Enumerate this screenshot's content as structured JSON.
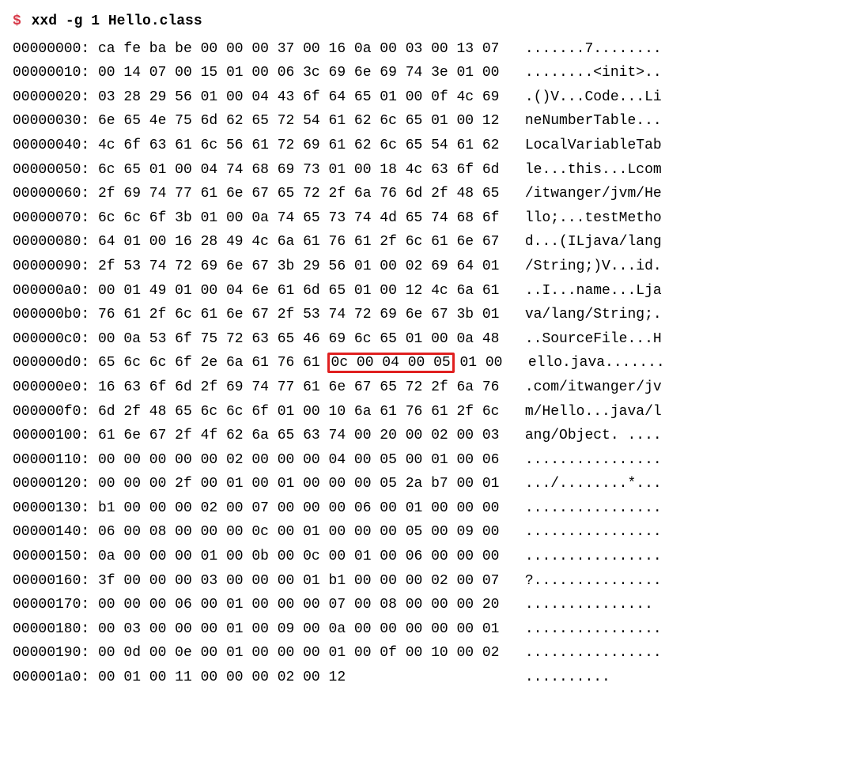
{
  "prompt": "$",
  "command": "xxd -g 1 Hello.class",
  "highlight": {
    "rowOffset": "000000d0",
    "startByte": 9,
    "endByte": 13
  },
  "rows": [
    {
      "offset": "00000000",
      "hex": [
        "ca",
        "fe",
        "ba",
        "be",
        "00",
        "00",
        "00",
        "37",
        "00",
        "16",
        "0a",
        "00",
        "03",
        "00",
        "13",
        "07"
      ],
      "ascii": ".......7........"
    },
    {
      "offset": "00000010",
      "hex": [
        "00",
        "14",
        "07",
        "00",
        "15",
        "01",
        "00",
        "06",
        "3c",
        "69",
        "6e",
        "69",
        "74",
        "3e",
        "01",
        "00"
      ],
      "ascii": "........<init>.."
    },
    {
      "offset": "00000020",
      "hex": [
        "03",
        "28",
        "29",
        "56",
        "01",
        "00",
        "04",
        "43",
        "6f",
        "64",
        "65",
        "01",
        "00",
        "0f",
        "4c",
        "69"
      ],
      "ascii": ".()V...Code...Li"
    },
    {
      "offset": "00000030",
      "hex": [
        "6e",
        "65",
        "4e",
        "75",
        "6d",
        "62",
        "65",
        "72",
        "54",
        "61",
        "62",
        "6c",
        "65",
        "01",
        "00",
        "12"
      ],
      "ascii": "neNumberTable..."
    },
    {
      "offset": "00000040",
      "hex": [
        "4c",
        "6f",
        "63",
        "61",
        "6c",
        "56",
        "61",
        "72",
        "69",
        "61",
        "62",
        "6c",
        "65",
        "54",
        "61",
        "62"
      ],
      "ascii": "LocalVariableTab"
    },
    {
      "offset": "00000050",
      "hex": [
        "6c",
        "65",
        "01",
        "00",
        "04",
        "74",
        "68",
        "69",
        "73",
        "01",
        "00",
        "18",
        "4c",
        "63",
        "6f",
        "6d"
      ],
      "ascii": "le...this...Lcom"
    },
    {
      "offset": "00000060",
      "hex": [
        "2f",
        "69",
        "74",
        "77",
        "61",
        "6e",
        "67",
        "65",
        "72",
        "2f",
        "6a",
        "76",
        "6d",
        "2f",
        "48",
        "65"
      ],
      "ascii": "/itwanger/jvm/He"
    },
    {
      "offset": "00000070",
      "hex": [
        "6c",
        "6c",
        "6f",
        "3b",
        "01",
        "00",
        "0a",
        "74",
        "65",
        "73",
        "74",
        "4d",
        "65",
        "74",
        "68",
        "6f"
      ],
      "ascii": "llo;...testMetho"
    },
    {
      "offset": "00000080",
      "hex": [
        "64",
        "01",
        "00",
        "16",
        "28",
        "49",
        "4c",
        "6a",
        "61",
        "76",
        "61",
        "2f",
        "6c",
        "61",
        "6e",
        "67"
      ],
      "ascii": "d...(ILjava/lang"
    },
    {
      "offset": "00000090",
      "hex": [
        "2f",
        "53",
        "74",
        "72",
        "69",
        "6e",
        "67",
        "3b",
        "29",
        "56",
        "01",
        "00",
        "02",
        "69",
        "64",
        "01"
      ],
      "ascii": "/String;)V...id."
    },
    {
      "offset": "000000a0",
      "hex": [
        "00",
        "01",
        "49",
        "01",
        "00",
        "04",
        "6e",
        "61",
        "6d",
        "65",
        "01",
        "00",
        "12",
        "4c",
        "6a",
        "61"
      ],
      "ascii": "..I...name...Lja"
    },
    {
      "offset": "000000b0",
      "hex": [
        "76",
        "61",
        "2f",
        "6c",
        "61",
        "6e",
        "67",
        "2f",
        "53",
        "74",
        "72",
        "69",
        "6e",
        "67",
        "3b",
        "01"
      ],
      "ascii": "va/lang/String;."
    },
    {
      "offset": "000000c0",
      "hex": [
        "00",
        "0a",
        "53",
        "6f",
        "75",
        "72",
        "63",
        "65",
        "46",
        "69",
        "6c",
        "65",
        "01",
        "00",
        "0a",
        "48"
      ],
      "ascii": "..SourceFile...H"
    },
    {
      "offset": "000000d0",
      "hex": [
        "65",
        "6c",
        "6c",
        "6f",
        "2e",
        "6a",
        "61",
        "76",
        "61",
        "0c",
        "00",
        "04",
        "00",
        "05",
        "01",
        "00"
      ],
      "ascii": "ello.java......."
    },
    {
      "offset": "000000e0",
      "hex": [
        "16",
        "63",
        "6f",
        "6d",
        "2f",
        "69",
        "74",
        "77",
        "61",
        "6e",
        "67",
        "65",
        "72",
        "2f",
        "6a",
        "76"
      ],
      "ascii": ".com/itwanger/jv"
    },
    {
      "offset": "000000f0",
      "hex": [
        "6d",
        "2f",
        "48",
        "65",
        "6c",
        "6c",
        "6f",
        "01",
        "00",
        "10",
        "6a",
        "61",
        "76",
        "61",
        "2f",
        "6c"
      ],
      "ascii": "m/Hello...java/l"
    },
    {
      "offset": "00000100",
      "hex": [
        "61",
        "6e",
        "67",
        "2f",
        "4f",
        "62",
        "6a",
        "65",
        "63",
        "74",
        "00",
        "20",
        "00",
        "02",
        "00",
        "03"
      ],
      "ascii": "ang/Object. ...."
    },
    {
      "offset": "00000110",
      "hex": [
        "00",
        "00",
        "00",
        "00",
        "00",
        "02",
        "00",
        "00",
        "00",
        "04",
        "00",
        "05",
        "00",
        "01",
        "00",
        "06"
      ],
      "ascii": "................"
    },
    {
      "offset": "00000120",
      "hex": [
        "00",
        "00",
        "00",
        "2f",
        "00",
        "01",
        "00",
        "01",
        "00",
        "00",
        "00",
        "05",
        "2a",
        "b7",
        "00",
        "01"
      ],
      "ascii": ".../........*..."
    },
    {
      "offset": "00000130",
      "hex": [
        "b1",
        "00",
        "00",
        "00",
        "02",
        "00",
        "07",
        "00",
        "00",
        "00",
        "06",
        "00",
        "01",
        "00",
        "00",
        "00"
      ],
      "ascii": "................"
    },
    {
      "offset": "00000140",
      "hex": [
        "06",
        "00",
        "08",
        "00",
        "00",
        "00",
        "0c",
        "00",
        "01",
        "00",
        "00",
        "00",
        "05",
        "00",
        "09",
        "00"
      ],
      "ascii": "................"
    },
    {
      "offset": "00000150",
      "hex": [
        "0a",
        "00",
        "00",
        "00",
        "01",
        "00",
        "0b",
        "00",
        "0c",
        "00",
        "01",
        "00",
        "06",
        "00",
        "00",
        "00"
      ],
      "ascii": "................"
    },
    {
      "offset": "00000160",
      "hex": [
        "3f",
        "00",
        "00",
        "00",
        "03",
        "00",
        "00",
        "00",
        "01",
        "b1",
        "00",
        "00",
        "00",
        "02",
        "00",
        "07"
      ],
      "ascii": "?..............."
    },
    {
      "offset": "00000170",
      "hex": [
        "00",
        "00",
        "00",
        "06",
        "00",
        "01",
        "00",
        "00",
        "00",
        "07",
        "00",
        "08",
        "00",
        "00",
        "00",
        "20"
      ],
      "ascii": "............... "
    },
    {
      "offset": "00000180",
      "hex": [
        "00",
        "03",
        "00",
        "00",
        "00",
        "01",
        "00",
        "09",
        "00",
        "0a",
        "00",
        "00",
        "00",
        "00",
        "00",
        "01"
      ],
      "ascii": "................"
    },
    {
      "offset": "00000190",
      "hex": [
        "00",
        "0d",
        "00",
        "0e",
        "00",
        "01",
        "00",
        "00",
        "00",
        "01",
        "00",
        "0f",
        "00",
        "10",
        "00",
        "02"
      ],
      "ascii": "................"
    },
    {
      "offset": "000001a0",
      "hex": [
        "00",
        "01",
        "00",
        "11",
        "00",
        "00",
        "00",
        "02",
        "00",
        "12"
      ],
      "ascii": ".........."
    }
  ]
}
